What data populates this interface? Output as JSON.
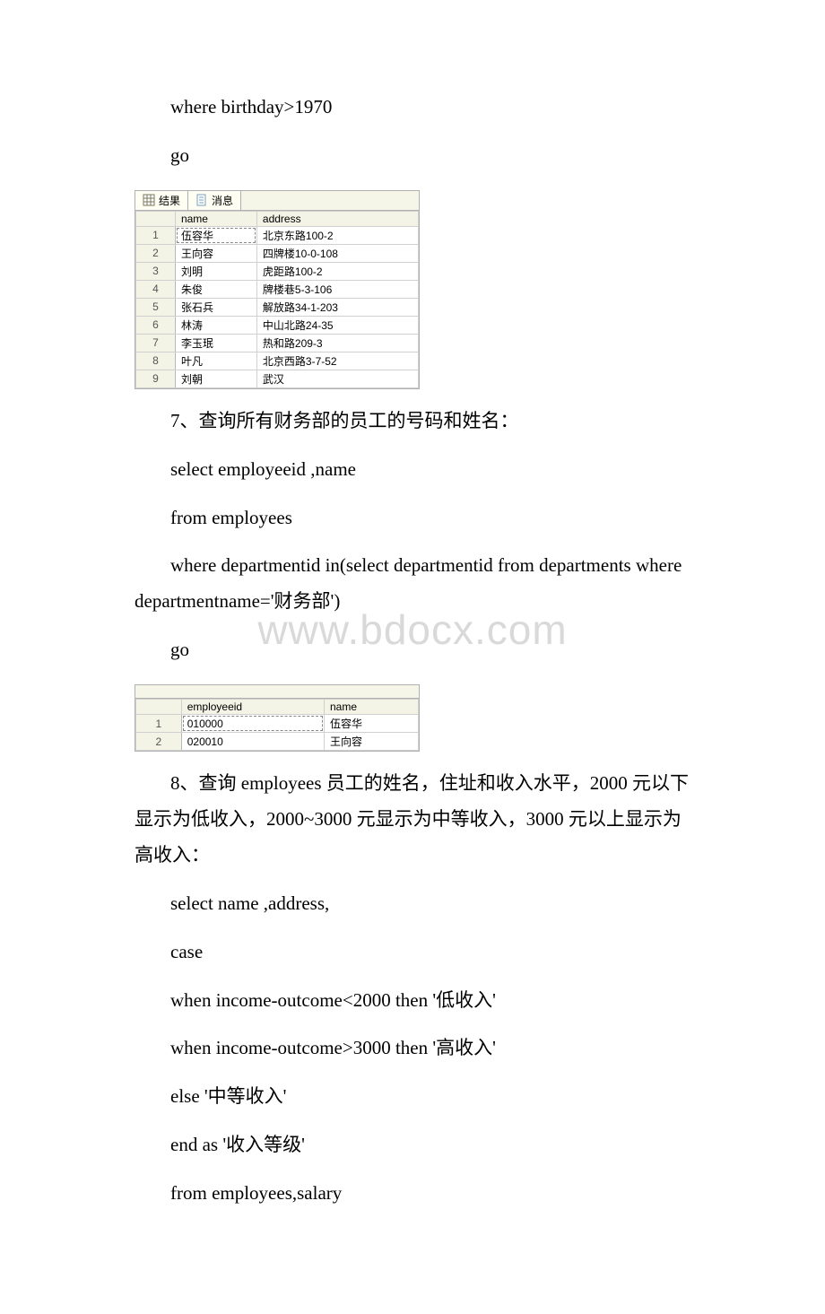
{
  "watermark": "www.bdocx.com",
  "lines": {
    "l1": "where birthday>1970",
    "l2": "go",
    "q7_title": "7、查询所有财务部的员工的号码和姓名：",
    "q7_c1": "select employeeid ,name",
    "q7_c2": "from employees",
    "q7_c3": "where departmentid in(select departmentid from departments where departmentname='财务部')",
    "q7_c4": "go",
    "q8_title": "8、查询 employees 员工的姓名，住址和收入水平，2000 元以下显示为低收入，2000~3000 元显示为中等收入，3000 元以上显示为高收入：",
    "q8_c1": "select name ,address,",
    "q8_c2": "case",
    "q8_c3": "when income-outcome<2000 then '低收入'",
    "q8_c4": "when income-outcome>3000 then '高收入'",
    "q8_c5": "else '中等收入'",
    "q8_c6": "end as '收入等级'",
    "q8_c7": "from employees,salary"
  },
  "tabs": {
    "results_label": "结果",
    "messages_label": "消息"
  },
  "table1": {
    "headers": [
      "name",
      "address"
    ],
    "rows": [
      {
        "n": "1",
        "c1": "伍容华",
        "c2": "北京东路100-2"
      },
      {
        "n": "2",
        "c1": "王向容",
        "c2": "四牌楼10-0-108"
      },
      {
        "n": "3",
        "c1": "刘明",
        "c2": "虎距路100-2"
      },
      {
        "n": "4",
        "c1": "朱俊",
        "c2": "牌楼巷5-3-106"
      },
      {
        "n": "5",
        "c1": "张石兵",
        "c2": "解放路34-1-203"
      },
      {
        "n": "6",
        "c1": "林涛",
        "c2": "中山北路24-35"
      },
      {
        "n": "7",
        "c1": "李玉珉",
        "c2": "热和路209-3"
      },
      {
        "n": "8",
        "c1": "叶凡",
        "c2": "北京西路3-7-52"
      },
      {
        "n": "9",
        "c1": "刘朝",
        "c2": "武汉"
      }
    ]
  },
  "table2": {
    "headers": [
      "employeeid",
      "name"
    ],
    "rows": [
      {
        "n": "1",
        "c1": "010000",
        "c2": "伍容华"
      },
      {
        "n": "2",
        "c1": "020010",
        "c2": "王向容"
      }
    ]
  }
}
